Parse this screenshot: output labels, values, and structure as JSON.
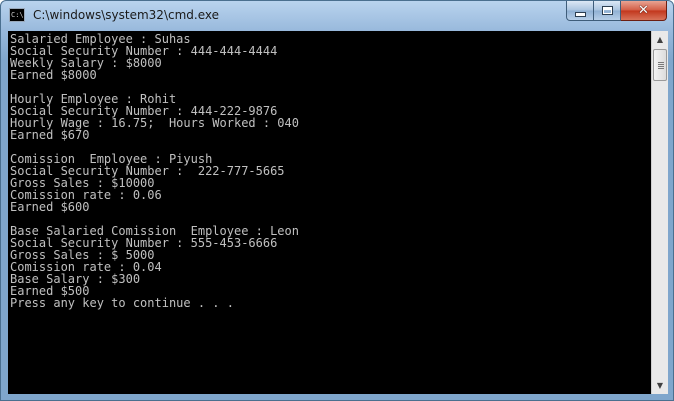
{
  "window": {
    "title": "C:\\windows\\system32\\cmd.exe",
    "app_icon_text": "C:\\"
  },
  "caption_buttons": {
    "close_glyph": "✕"
  },
  "console": {
    "lines": [
      "Salaried Employee : Suhas",
      "Social Security Number : 444-444-4444",
      "Weekly Salary : $8000",
      "Earned $8000",
      "",
      "Hourly Employee : Rohit",
      "Social Security Number : 444-222-9876",
      "Hourly Wage : 16.75;  Hours Worked : 040",
      "Earned $670",
      "",
      "Comission  Employee : Piyush",
      "Social Security Number :  222-777-5665",
      "Gross Sales : $10000",
      "Comission rate : 0.06",
      "Earned $600",
      "",
      "Base Salaried Comission  Employee : Leon",
      "Social Security Number : 555-453-6666",
      "Gross Sales : $ 5000",
      "Comission rate : 0.04",
      "Base Salary : $300",
      "Earned $500",
      "Press any key to continue . . ."
    ]
  },
  "scrollbar": {
    "up_arrow": "▲",
    "down_arrow": "▼"
  }
}
